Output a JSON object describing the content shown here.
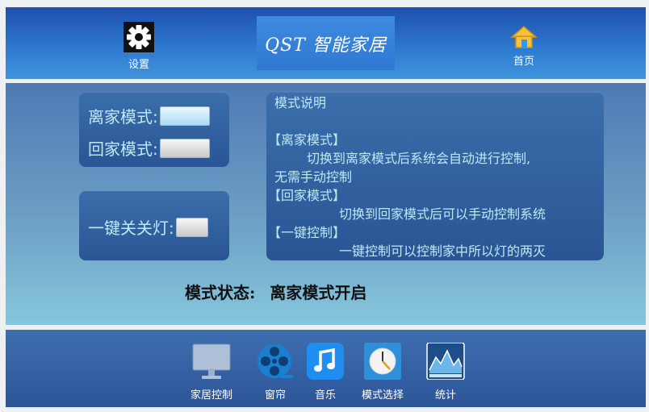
{
  "header": {
    "settings_label": "设置",
    "home_label": "首页",
    "brand": "QST 智能家居"
  },
  "modes": {
    "away_label": "离家模式:",
    "home_label": "回家模式:",
    "onekey_label": "一键关关灯:"
  },
  "description": {
    "title": "模式说明",
    "away_head": "【离家模式】",
    "away_text1": "切换到离家模式后系统会自动进行控制,",
    "away_text2": "无需手动控制",
    "home_head": "【回家模式】",
    "home_text": "切换到回家模式后可以手动控制系统",
    "onekey_head": "【一键控制】",
    "onekey_text": "一键控制可以控制家中所以灯的两灭"
  },
  "status": {
    "label": "模式状态:",
    "value": "离家模式开启"
  },
  "dock": [
    {
      "label": "家居控制",
      "icon": "monitor-icon"
    },
    {
      "label": "窗帘",
      "icon": "film-reel-icon"
    },
    {
      "label": "音乐",
      "icon": "music-icon"
    },
    {
      "label": "模式选择",
      "icon": "clock-icon"
    },
    {
      "label": "统计",
      "icon": "chart-icon"
    }
  ]
}
